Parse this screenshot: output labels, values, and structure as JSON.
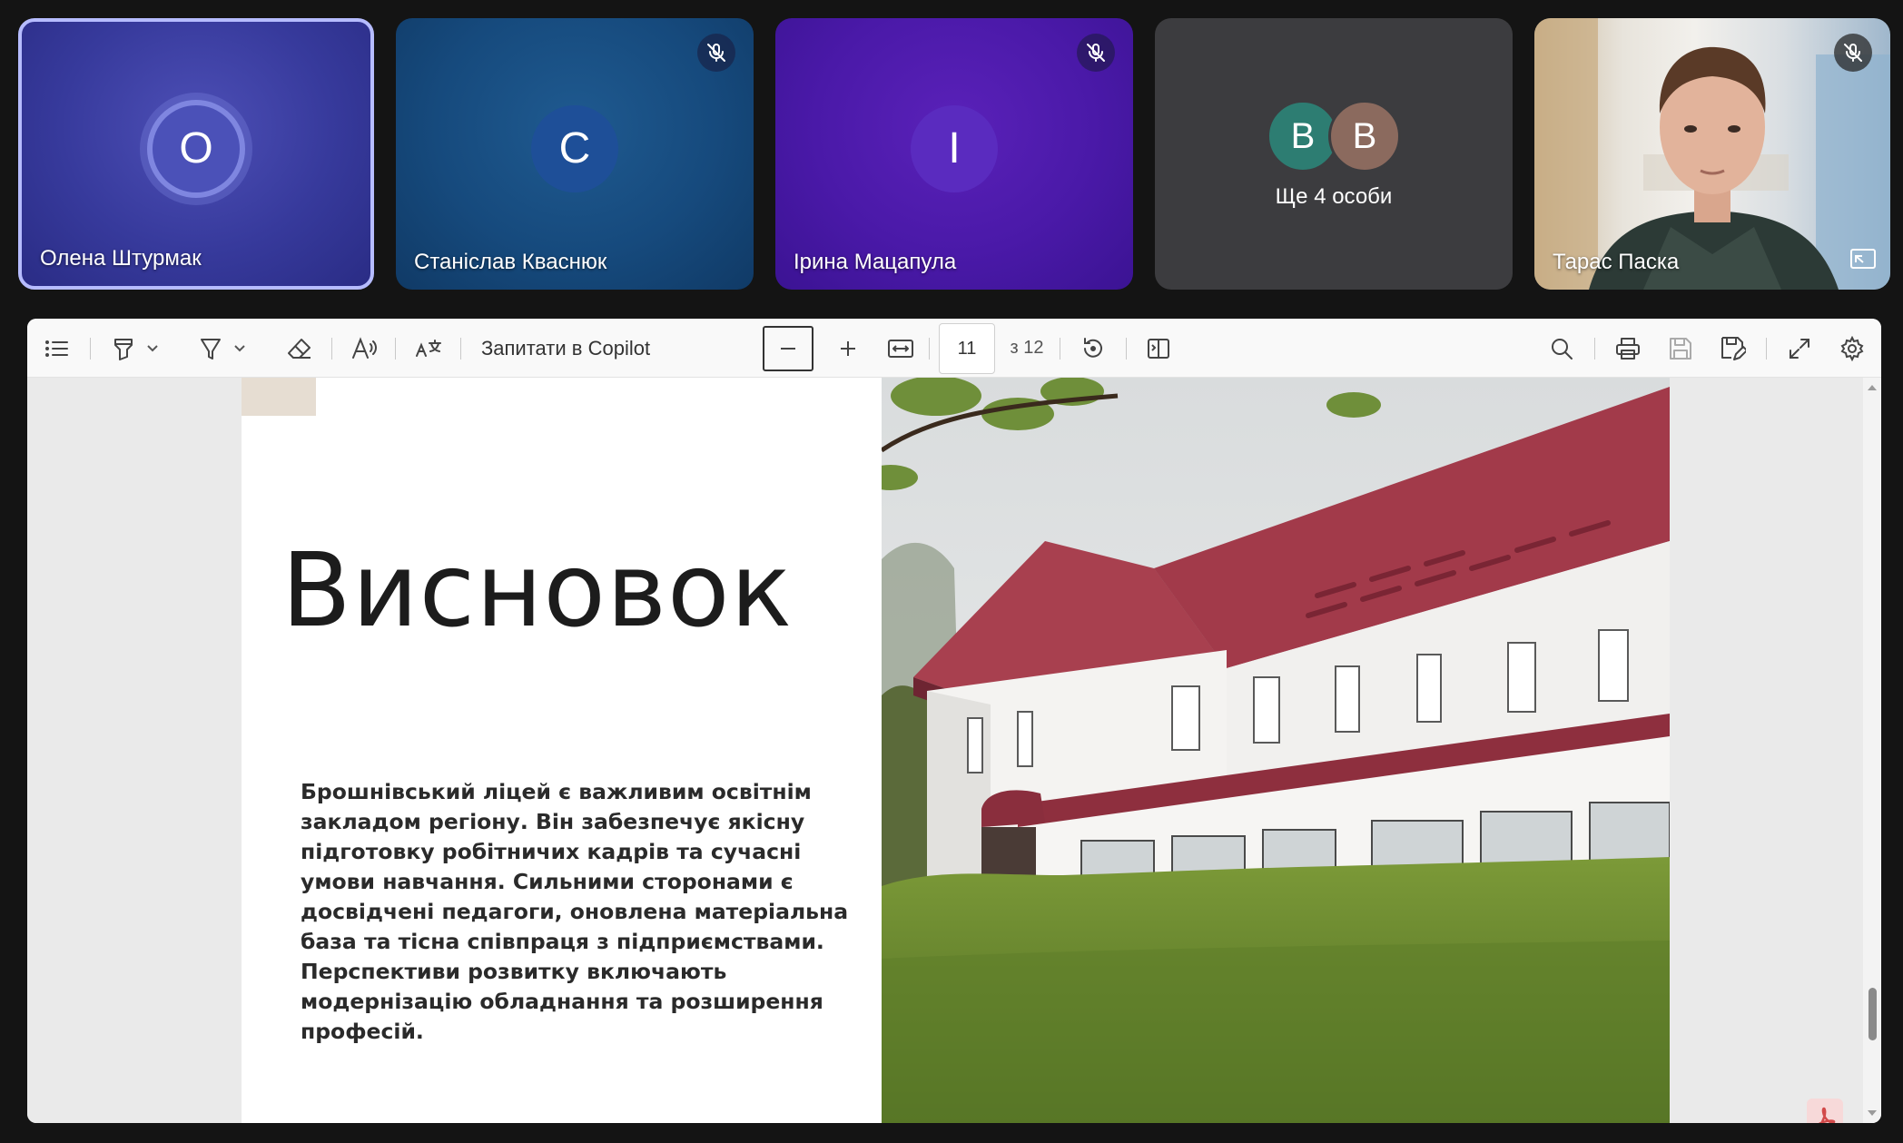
{
  "participants": [
    {
      "initial": "О",
      "name": "Олена Штурмак",
      "muted": false,
      "active_speaker": true
    },
    {
      "initial": "С",
      "name": "Станіслав Кваснюк",
      "muted": true
    },
    {
      "initial": "І",
      "name": "Ірина Мацапула",
      "muted": true
    },
    {
      "group_initials": [
        "В",
        "В"
      ],
      "more_label": "Ще 4 особи"
    },
    {
      "name": "Тарас Паска",
      "muted": true,
      "video": true
    }
  ],
  "toolbar": {
    "ask_copilot": "Запитати в Copilot",
    "page_current": "11",
    "page_total": "з 12",
    "icons": [
      "contents-icon",
      "highlight-icon",
      "chevron-down-icon",
      "draw-icon",
      "chevron-down-icon",
      "eraser-icon",
      "read-aloud-icon",
      "translate-icon",
      "zoom-out-icon",
      "zoom-in-icon",
      "fit-page-icon",
      "rotate-icon",
      "page-view-icon",
      "search-icon",
      "print-icon",
      "save-icon",
      "save-as-icon",
      "fullscreen-icon",
      "settings-icon"
    ]
  },
  "slide": {
    "title": "Висновок",
    "body": "Брошнівський ліцей є важливим освітнім закладом регіону. Він забезпечує якісну підготовку робітничих кадрів та сучасні умови навчання. Сильними сторонами є досвідчені педагоги, оновлена матеріальна база та тісна співпраця з підприємствами. Перспективи розвитку включають модернізацію обладнання та розширення професій.",
    "image": "school-building-photo"
  },
  "colors": {
    "background": "#141414",
    "active_border": "#b6bcff",
    "roof": "#9e3347"
  }
}
